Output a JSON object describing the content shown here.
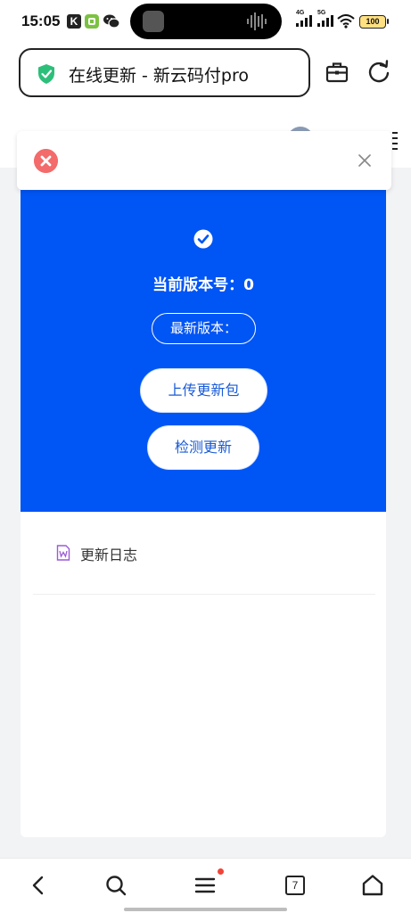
{
  "status_bar": {
    "time": "15:05",
    "app_k_label": "K",
    "signal_1_label": "4G",
    "signal_2_label": "5G",
    "battery": "100"
  },
  "browser": {
    "url_title": "在线更新 - 新云码付pro",
    "secure_color": "#2dbf7a"
  },
  "dialog": {
    "current_version_label": "当前版本号：0",
    "latest_version_label": "最新版本：",
    "upload_button": "上传更新包",
    "check_button": "检测更新",
    "log_label": "更新日志",
    "hero_color": "#0055f5",
    "error_color": "#f36b6b"
  },
  "bottom_nav": {
    "tab_count": "7",
    "icons": [
      "back-icon",
      "search-icon",
      "menu-icon",
      "tabs-icon",
      "home-icon"
    ]
  }
}
